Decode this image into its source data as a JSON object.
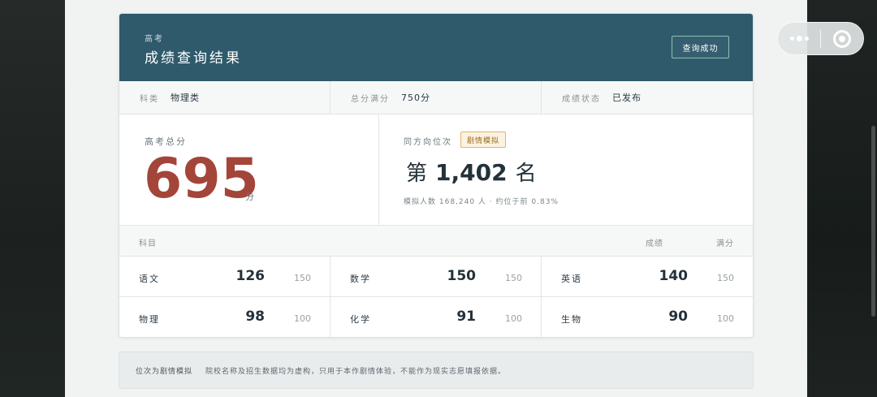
{
  "header": {
    "subtitle": "高考",
    "title": "成绩查询结果",
    "status_button": "查询成功"
  },
  "meta": [
    {
      "label": "科类",
      "value": "物理类"
    },
    {
      "label": "总分满分",
      "value": "750分"
    },
    {
      "label": "成绩状态",
      "value": "已发布"
    }
  ],
  "total": {
    "label": "高考总分",
    "score": "695",
    "unit": "分"
  },
  "rank": {
    "label": "同方向位次",
    "badge": "剧情模拟",
    "prefix": "第",
    "number": "1,402",
    "suffix": "名",
    "note": "模拟人数 168,240 人 · 约位于前 0.83%"
  },
  "subjects_header": {
    "subject": "科目",
    "score": "成绩",
    "full": "满分"
  },
  "subjects": [
    {
      "name": "语文",
      "score": "126",
      "full": "150"
    },
    {
      "name": "数学",
      "score": "150",
      "full": "150"
    },
    {
      "name": "英语",
      "score": "140",
      "full": "150"
    },
    {
      "name": "物理",
      "score": "98",
      "full": "100"
    },
    {
      "name": "化学",
      "score": "91",
      "full": "100"
    },
    {
      "name": "生物",
      "score": "90",
      "full": "100"
    }
  ],
  "footer": {
    "tag": "位次为剧情模拟",
    "text": "院校名称及招生数据均为虚构，只用于本作剧情体验，不能作为现实志愿填报依据。"
  },
  "colors": {
    "header_bg": "#2f5a6c",
    "total_score": "#a4453a",
    "badge_border": "#e4b46b"
  },
  "icons": [
    "more-icon",
    "close-icon"
  ]
}
